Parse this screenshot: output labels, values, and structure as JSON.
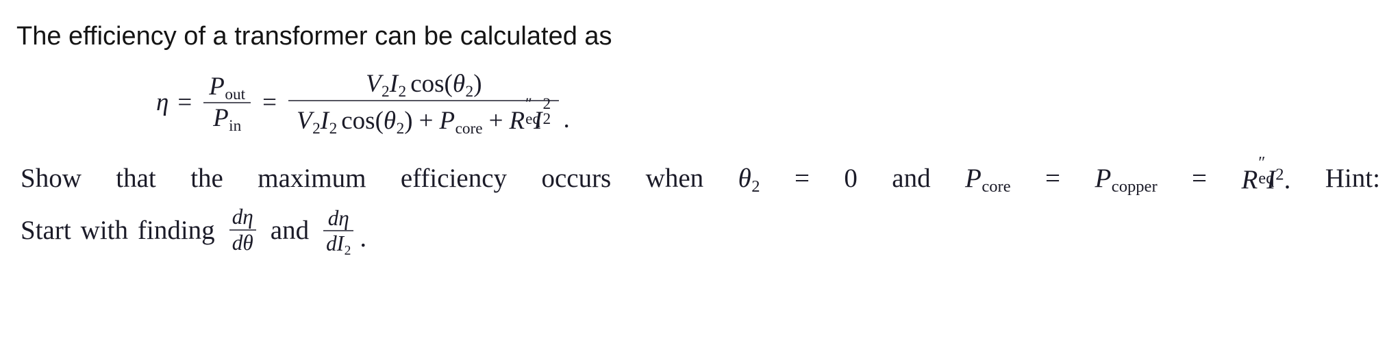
{
  "document": {
    "background_color": "#ffffff",
    "text_color": "#1b1b28",
    "intro_text": "The efficiency of a transformer can be calculated as"
  },
  "equation": {
    "plain": "eta = P_out / P_in = (V2 I2 cos(theta2)) / (V2 I2 cos(theta2) + P_core + R''_eq I2^2).",
    "eta_symbol": "η",
    "equals_1": "=",
    "equals_2": "=",
    "left_fraction": {
      "numerator_base": "P",
      "numerator_sub": "out",
      "denominator_base": "P",
      "denominator_sub": "in"
    },
    "right_fraction": {
      "numerator": {
        "v_base": "V",
        "v_sub": "2",
        "i_base": "I",
        "i_sub": "2",
        "cos": "cos",
        "open_paren": "(",
        "theta": "θ",
        "theta_sub": "2",
        "close_paren": ")"
      },
      "denominator": {
        "v_base": "V",
        "v_sub": "2",
        "i_base": "I",
        "i_sub": "2",
        "cos": "cos",
        "open_paren": "(",
        "theta": "θ",
        "theta_sub": "2",
        "close_paren": ")",
        "plus_1": "+",
        "p_base": "P",
        "p_sub": "core",
        "plus_2": "+",
        "r_base": "R",
        "r_prime": "″",
        "r_sub": "eq",
        "i2_base": "I",
        "i2_sub": "2",
        "i2_sup": "2"
      }
    },
    "trailing_period": "."
  },
  "problem": {
    "line1": {
      "w1": "Show",
      "w2": "that",
      "w3": "the",
      "w4": "maximum",
      "w5": "efficiency",
      "w6": "occurs",
      "w7": "when",
      "theta": "θ",
      "theta_sub": "2",
      "eq1": "=",
      "zero": "0",
      "and": "and",
      "p_core_base": "P",
      "p_core_sub": "core",
      "eq2": "=",
      "p_copper_base": "P",
      "p_copper_sub": "copper",
      "eq3": "=",
      "r_base": "R",
      "r_prime": "″",
      "r_sub": "eq",
      "i_base": "I",
      "i_sup": "2",
      "period": ".",
      "hint": "Hint:"
    },
    "line2": {
      "start": "Start",
      "with": "with",
      "finding": "finding",
      "frac1_num_d": "d",
      "frac1_num_eta": "η",
      "frac1_den_d": "d",
      "frac1_den_theta": "θ",
      "and": "and",
      "frac2_num_d": "d",
      "frac2_num_eta": "η",
      "frac2_den_d": "d",
      "frac2_den_I": "I",
      "frac2_den_sub": "2",
      "period": "."
    }
  }
}
